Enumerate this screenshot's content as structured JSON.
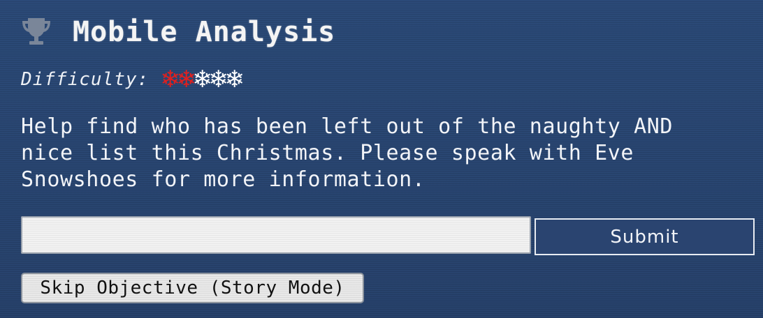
{
  "objective": {
    "title": "Mobile Analysis",
    "icon": "trophy-icon",
    "difficulty_label": "Difficulty:",
    "difficulty_level": 2,
    "difficulty_max": 5,
    "difficulty_glyph": "❄",
    "difficulty_active_color": "#e0201f",
    "difficulty_inactive_color": "#ffffff",
    "description": "Help find who has been left out of the naughty AND nice list this Christmas. Please speak with Eve Snowshoes for more information."
  },
  "answer": {
    "value": "",
    "placeholder": ""
  },
  "buttons": {
    "submit_label": "Submit",
    "skip_label": "Skip Objective (Story Mode)"
  },
  "colors": {
    "background": "#2a4674",
    "trophy": "#7a8699"
  }
}
